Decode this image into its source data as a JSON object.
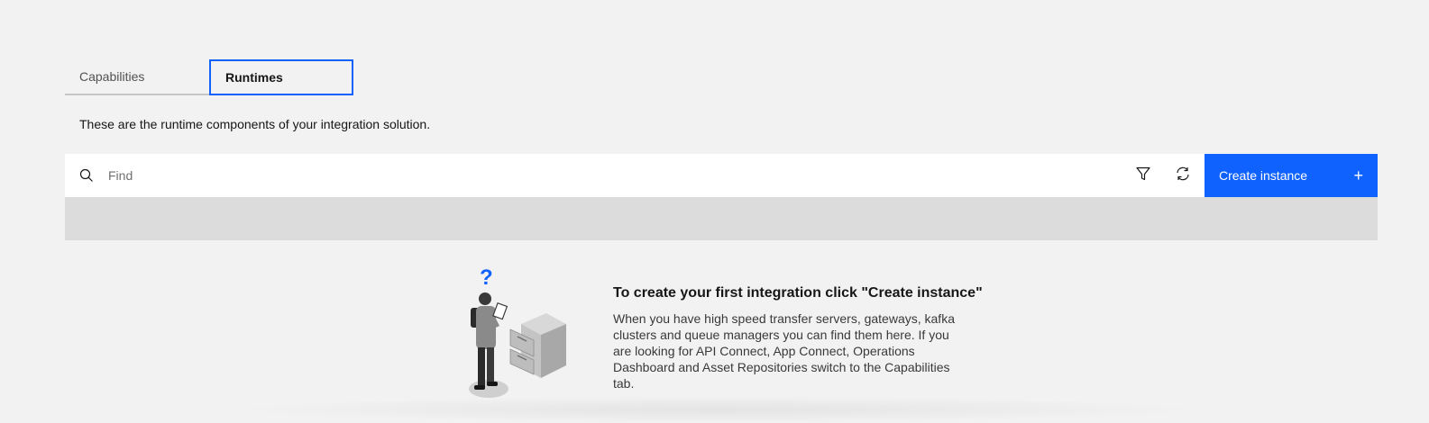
{
  "tabs": [
    {
      "label": "Capabilities",
      "active": false
    },
    {
      "label": "Runtimes",
      "active": true
    }
  ],
  "description": "These are the runtime components of your integration solution.",
  "toolbar": {
    "search_placeholder": "Find",
    "create_label": "Create instance",
    "create_icon": "+"
  },
  "empty_state": {
    "question_mark": "?",
    "title": "To create your first integration click \"Create instance\"",
    "body": "When you have high speed transfer servers, gateways, kafka clusters and queue managers you can find them here. If you are looking for API Connect, App Connect, Operations Dashboard and Asset Repositories switch to the Capabilities tab."
  },
  "colors": {
    "accent": "#0f62fe",
    "background": "#f2f2f2",
    "table_header": "#dcdcdc"
  }
}
